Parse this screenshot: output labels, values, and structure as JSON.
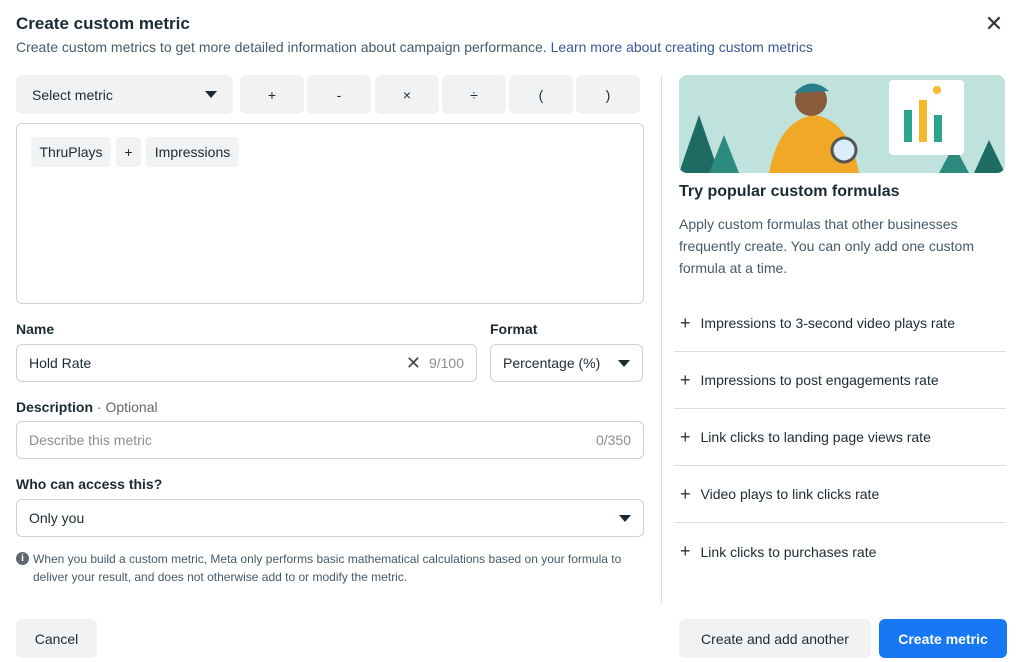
{
  "header": {
    "title": "Create custom metric",
    "subtitle": "Create custom metrics to get more detailed information about campaign performance.",
    "learn_more": "Learn more about creating custom metrics"
  },
  "toolbar": {
    "select_metric": "Select metric",
    "operators": [
      "+",
      "-",
      "×",
      "÷",
      "(",
      ")"
    ]
  },
  "formula": {
    "tokens": [
      "ThruPlays",
      "+",
      "Impressions"
    ]
  },
  "name": {
    "label": "Name",
    "value": "Hold Rate",
    "count": "9/100"
  },
  "format": {
    "label": "Format",
    "value": "Percentage (%)"
  },
  "description": {
    "label": "Description",
    "optional": "· Optional",
    "placeholder": "Describe this metric",
    "count": "0/350"
  },
  "access": {
    "label": "Who can access this?",
    "value": "Only you"
  },
  "note": "When you build a custom metric, Meta only performs basic mathematical calculations based on your formula to deliver your result, and does not otherwise add to or modify the metric.",
  "popular": {
    "title": "Try popular custom formulas",
    "text": "Apply custom formulas that other businesses frequently create. You can only add one custom formula at a time.",
    "items": [
      "Impressions to 3-second video plays rate",
      "Impressions to post engagements rate",
      "Link clicks to landing page views rate",
      "Video plays to link clicks rate",
      "Link clicks to purchases rate"
    ]
  },
  "footer": {
    "cancel": "Cancel",
    "create_another": "Create and add another",
    "create": "Create metric"
  },
  "colors": {
    "primary": "#1877f2",
    "link": "#385898",
    "illustration_bg": "#bfe3dc"
  }
}
